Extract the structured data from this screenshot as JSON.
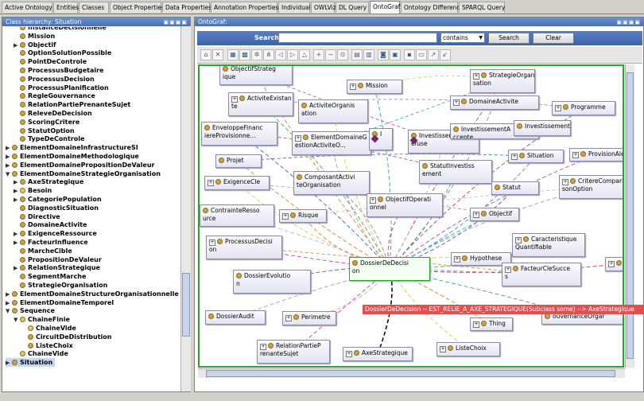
{
  "tabs": [
    "Active Ontology",
    "Entities",
    "Classes",
    "Object Properties",
    "Data Properties",
    "Annotation Properties",
    "Individuals",
    "OWLViz",
    "DL Query",
    "OntoGraf",
    "Ontology Differences",
    "SPARQL Query"
  ],
  "active_tab": "OntoGraf",
  "left_panel": {
    "title": "Class hierarchy: Situation",
    "title_buttons": "▣▣▣▣",
    "tree": [
      {
        "label": "InstanceDecisionnelle",
        "toggle": "",
        "dot": "full",
        "indent": 1
      },
      {
        "label": "Mission",
        "toggle": "",
        "dot": "full",
        "indent": 1
      },
      {
        "label": "Objectif",
        "toggle": "▶",
        "dot": "full",
        "indent": 1
      },
      {
        "label": "OptionSolutionPossible",
        "toggle": "",
        "dot": "full",
        "indent": 1
      },
      {
        "label": "PointDeControle",
        "toggle": "",
        "dot": "full",
        "indent": 1
      },
      {
        "label": "ProcessusBudgetaire",
        "toggle": "",
        "dot": "full",
        "indent": 1
      },
      {
        "label": "ProcessusDecision",
        "toggle": "",
        "dot": "full",
        "indent": 1
      },
      {
        "label": "ProcessusPlanification",
        "toggle": "",
        "dot": "full",
        "indent": 1
      },
      {
        "label": "RegleGouvernance",
        "toggle": "",
        "dot": "full",
        "indent": 1
      },
      {
        "label": "RelationPartiePrenanteSujet",
        "toggle": "",
        "dot": "full",
        "indent": 1
      },
      {
        "label": "ReleveDeDecision",
        "toggle": "",
        "dot": "full",
        "indent": 1
      },
      {
        "label": "ScoringCritere",
        "toggle": "",
        "dot": "full",
        "indent": 1
      },
      {
        "label": "StatutOption",
        "toggle": "",
        "dot": "full",
        "indent": 1
      },
      {
        "label": "TypeDeControle",
        "toggle": "",
        "dot": "full",
        "indent": 1
      },
      {
        "label": "ElementDomaineInfrastructureSI",
        "toggle": "▶",
        "dot": "full",
        "indent": 0
      },
      {
        "label": "ElementDomaineMethodologique",
        "toggle": "▶",
        "dot": "full",
        "indent": 0
      },
      {
        "label": "ElementDomainePropositionDeValeur",
        "toggle": "▶",
        "dot": "full",
        "indent": 0
      },
      {
        "label": "ElementDomaineStrategieOrganisation",
        "toggle": "▼",
        "dot": "full",
        "indent": 0
      },
      {
        "label": "AxeStrategique",
        "toggle": "▶",
        "dot": "full",
        "indent": 1
      },
      {
        "label": "Besoin",
        "toggle": "▶",
        "dot": "half",
        "indent": 1
      },
      {
        "label": "CategoriePopulation",
        "toggle": "▶",
        "dot": "full",
        "indent": 1
      },
      {
        "label": "DiagnosticSituation",
        "toggle": "",
        "dot": "full",
        "indent": 1
      },
      {
        "label": "Directive",
        "toggle": "",
        "dot": "full",
        "indent": 1
      },
      {
        "label": "DomaineActivite",
        "toggle": "",
        "dot": "full",
        "indent": 1
      },
      {
        "label": "ExigenceRessource",
        "toggle": "▶",
        "dot": "full",
        "indent": 1
      },
      {
        "label": "FacteurInfluence",
        "toggle": "▶",
        "dot": "full",
        "indent": 1
      },
      {
        "label": "MarcheCible",
        "toggle": "",
        "dot": "full",
        "indent": 1
      },
      {
        "label": "PropositionDeValeur",
        "toggle": "",
        "dot": "full",
        "indent": 1
      },
      {
        "label": "RelationStrategique",
        "toggle": "▶",
        "dot": "full",
        "indent": 1
      },
      {
        "label": "SegmentMarche",
        "toggle": "",
        "dot": "full",
        "indent": 1
      },
      {
        "label": "StrategieOrganisation",
        "toggle": "",
        "dot": "full",
        "indent": 1
      },
      {
        "label": "ElementDomaineStructureOrganisationnelle",
        "toggle": "▶",
        "dot": "full",
        "indent": 0
      },
      {
        "label": "ElementDomaineTemporel",
        "toggle": "▶",
        "dot": "full",
        "indent": 0
      },
      {
        "label": "Sequence",
        "toggle": "▼",
        "dot": "full",
        "indent": 0
      },
      {
        "label": "ChaineFinie",
        "toggle": "▼",
        "dot": "half",
        "indent": 1
      },
      {
        "label": "ChaineVide",
        "toggle": "",
        "dot": "half",
        "indent": 2
      },
      {
        "label": "CircuitDeDistribution",
        "toggle": "",
        "dot": "full",
        "indent": 2
      },
      {
        "label": "ListeChoix",
        "toggle": "",
        "dot": "full",
        "indent": 2
      },
      {
        "label": "ChaineVide",
        "toggle": "",
        "dot": "half",
        "indent": 1
      },
      {
        "label": "Situation",
        "toggle": "▶",
        "dot": "full",
        "indent": 0,
        "selected": true
      }
    ]
  },
  "right_panel": {
    "title": "OntoGraf:",
    "title_buttons": "▣▣▣▣",
    "search": {
      "label": "Search:",
      "value": "",
      "mode": "contains",
      "search_button": "Search",
      "clear_button": "Clear"
    },
    "toolbar_icons": [
      "home-icon",
      "clear-icon",
      "grid-layout-icon",
      "grid2-layout-icon",
      "radial-layout-icon",
      "tree-layout-icon",
      "tree-left-layout-icon",
      "tree-right-layout-icon",
      "tree-down-layout-icon",
      "zoom-in-icon",
      "zoom-out-icon",
      "zoom-fit-icon",
      "filter-icon",
      "filter2-icon",
      "camera-icon",
      "export-image-icon",
      "save-icon",
      "open-icon",
      "export-icon",
      "import-icon"
    ],
    "nodes": [
      {
        "id": "objectif-strategique",
        "label": "ObjectifStrateg\nique",
        "plus": false
      },
      {
        "id": "mission",
        "label": "Mission",
        "plus": true
      },
      {
        "id": "strategie-organisation",
        "label": "StrategieOrgani\nsation",
        "plus": true
      },
      {
        "id": "activite-existante",
        "label": "ActiviteExistan\nte",
        "plus": true
      },
      {
        "id": "activite-organisation",
        "label": "ActiviteOrganis\nation",
        "plus": false
      },
      {
        "id": "domaine-activite",
        "label": "DomaineActivite",
        "plus": true
      },
      {
        "id": "programme",
        "label": "Programme",
        "plus": true
      },
      {
        "id": "enveloppe-financiere",
        "label": "EnveloppeFinanc\niereProvisionne...",
        "plus": false
      },
      {
        "id": "element-domaine-gestion",
        "label": "ElementDomaineG\nestionActiviteO...",
        "plus": true
      },
      {
        "id": "i-node",
        "label": "I",
        "plus": false,
        "diamond": true
      },
      {
        "id": "investissement-refuse",
        "label": "InvestissementR\nefuse",
        "plus": false,
        "diamond": true
      },
      {
        "id": "investissement-a",
        "label": "InvestissementA\nccepte",
        "plus": false
      },
      {
        "id": "investissements",
        "label": "InvestissementS",
        "plus": false
      },
      {
        "id": "projet",
        "label": "Projet",
        "plus": false
      },
      {
        "id": "situation",
        "label": "Situation",
        "plus": true
      },
      {
        "id": "provision-alea",
        "label": "ProvisionAlea",
        "plus": true
      },
      {
        "id": "statut-investissement",
        "label": "StatutInvestiss\nement",
        "plus": false
      },
      {
        "id": "exigence-cle",
        "label": "ExigenceCle",
        "plus": true
      },
      {
        "id": "composant-activite",
        "label": "ComposantActivi\nteOrganisation",
        "plus": false
      },
      {
        "id": "objectif-operationnel",
        "label": "ObjectifOperati\nonnel",
        "plus": true
      },
      {
        "id": "statut",
        "label": "Statut",
        "plus": false
      },
      {
        "id": "critere-comparaison",
        "label": "CritereCompari\nsonOption",
        "plus": true
      },
      {
        "id": "contrainte-ressource",
        "label": "ContrainteResso\nurce",
        "plus": false
      },
      {
        "id": "risque",
        "label": "Risque",
        "plus": true
      },
      {
        "id": "objectif",
        "label": "Objectif",
        "plus": true
      },
      {
        "id": "processus-decision",
        "label": "ProcessusDecisi\non",
        "plus": true
      },
      {
        "id": "caracteristique-quantifiable",
        "label": "Caracteristique\nQuantifiable",
        "plus": true
      },
      {
        "id": "dossier-de-decision",
        "label": "DossierDeDecisi\non",
        "plus": false,
        "selected": true
      },
      {
        "id": "hypothese",
        "label": "Hypothese",
        "plus": true
      },
      {
        "id": "facteur-cle-succes",
        "label": "FacteurCleSucce\ns",
        "plus": true
      },
      {
        "id": "s-node",
        "label": "S",
        "plus": true
      },
      {
        "id": "dossier-evolution",
        "label": "DossierEvolutio\nn",
        "plus": false
      },
      {
        "id": "dossier-audit",
        "label": "DossierAudit",
        "plus": false
      },
      {
        "id": "perimetre",
        "label": "Perimetre",
        "plus": true
      },
      {
        "id": "thing",
        "label": "Thing",
        "plus": true
      },
      {
        "id": "gouvernance-organ",
        "label": "ouvernanceOrgar",
        "plus": false
      },
      {
        "id": "relation-partie-prenante",
        "label": "RelationPartieP\nrenanteSujet",
        "plus": true
      },
      {
        "id": "axe-strategique",
        "label": "AxeStrategique",
        "plus": true
      },
      {
        "id": "liste-choix",
        "label": "ListeChoix",
        "plus": true
      }
    ],
    "tooltip": "DossierDeDecision -- EST_RELIE_A_AXE_STRATEGIQUE(Subclass some) --> AxeStrategique"
  }
}
